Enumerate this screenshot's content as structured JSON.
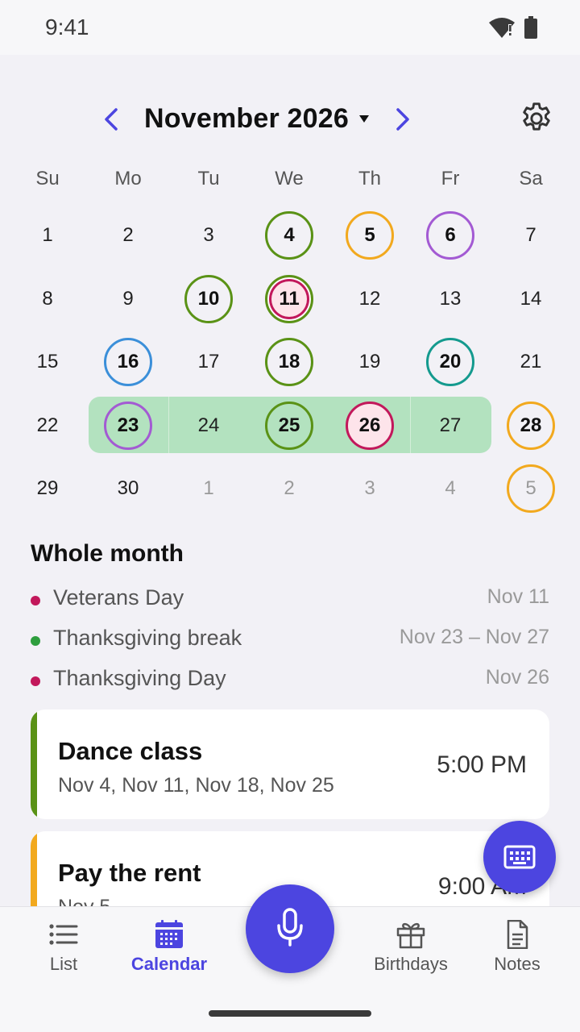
{
  "status_bar": {
    "time": "9:41",
    "wifi_icon": "wifi-alert-icon",
    "battery_icon": "battery-icon"
  },
  "header": {
    "month_label": "November 2026",
    "prev_icon": "chevron-left-icon",
    "next_icon": "chevron-right-icon",
    "dropdown_icon": "caret-down-icon",
    "settings_icon": "gear-icon"
  },
  "weekdays": [
    "Su",
    "Mo",
    "Tu",
    "We",
    "Th",
    "Fr",
    "Sa"
  ],
  "calendar": {
    "weeks": [
      [
        {
          "d": "1"
        },
        {
          "d": "2"
        },
        {
          "d": "3"
        },
        {
          "d": "4",
          "ring": "#5a9216",
          "bold": true
        },
        {
          "d": "5",
          "ring": "#f2a91e",
          "bold": true
        },
        {
          "d": "6",
          "ring": "#a35ad3",
          "bold": true
        },
        {
          "d": "7"
        }
      ],
      [
        {
          "d": "8"
        },
        {
          "d": "9"
        },
        {
          "d": "10",
          "ring": "#5a9216",
          "bold": true
        },
        {
          "d": "11",
          "ring": "#5a9216",
          "inner": "#c2185b",
          "bold": true
        },
        {
          "d": "12"
        },
        {
          "d": "13"
        },
        {
          "d": "14"
        }
      ],
      [
        {
          "d": "15"
        },
        {
          "d": "16",
          "ring": "#3b8fd9",
          "bold": true
        },
        {
          "d": "17"
        },
        {
          "d": "18",
          "ring": "#5a9216",
          "bold": true
        },
        {
          "d": "19"
        },
        {
          "d": "20",
          "ring": "#149a8e",
          "bold": true
        },
        {
          "d": "21"
        }
      ],
      [
        {
          "d": "22"
        },
        {
          "d": "23",
          "ring": "#a35ad3",
          "bold": true
        },
        {
          "d": "24"
        },
        {
          "d": "25",
          "ring": "#5a9216",
          "bold": true
        },
        {
          "d": "26",
          "ring": "#c2185b",
          "fill": "#fde4ea",
          "bold": true
        },
        {
          "d": "27"
        },
        {
          "d": "28",
          "ring": "#f2a91e",
          "bold": true
        }
      ],
      [
        {
          "d": "29"
        },
        {
          "d": "30"
        },
        {
          "d": "1",
          "muted": true
        },
        {
          "d": "2",
          "muted": true
        },
        {
          "d": "3",
          "muted": true
        },
        {
          "d": "4",
          "muted": true
        },
        {
          "d": "5",
          "muted": true,
          "ring": "#f2a91e"
        }
      ]
    ],
    "range_color": "#b3e2bf"
  },
  "whole_month": {
    "title": "Whole month",
    "items": [
      {
        "name": "Veterans Day",
        "date": "Nov 11",
        "color": "#c2185b"
      },
      {
        "name": "Thanksgiving break",
        "date": "Nov 23 – Nov 27",
        "color": "#2e9e3e"
      },
      {
        "name": "Thanksgiving Day",
        "date": "Nov 26",
        "color": "#c2185b"
      }
    ]
  },
  "events": [
    {
      "title": "Dance class",
      "dates": "Nov 4, Nov 11, Nov 18, Nov 25",
      "time": "5:00 PM",
      "color": "#5a9216"
    },
    {
      "title": "Pay the rent",
      "dates": "Nov 5",
      "time": "9:00 AM",
      "color": "#f2a91e"
    }
  ],
  "fabs": {
    "keyboard_icon": "keyboard-icon",
    "mic_icon": "microphone-icon"
  },
  "bottom_nav": {
    "items": [
      {
        "label": "List",
        "icon": "list-icon"
      },
      {
        "label": "Calendar",
        "icon": "calendar-icon",
        "active": true
      },
      {
        "label": "Birthdays",
        "icon": "gift-icon"
      },
      {
        "label": "Notes",
        "icon": "note-icon"
      }
    ]
  },
  "colors": {
    "accent": "#4c45e0",
    "background": "#f2f1f6"
  }
}
